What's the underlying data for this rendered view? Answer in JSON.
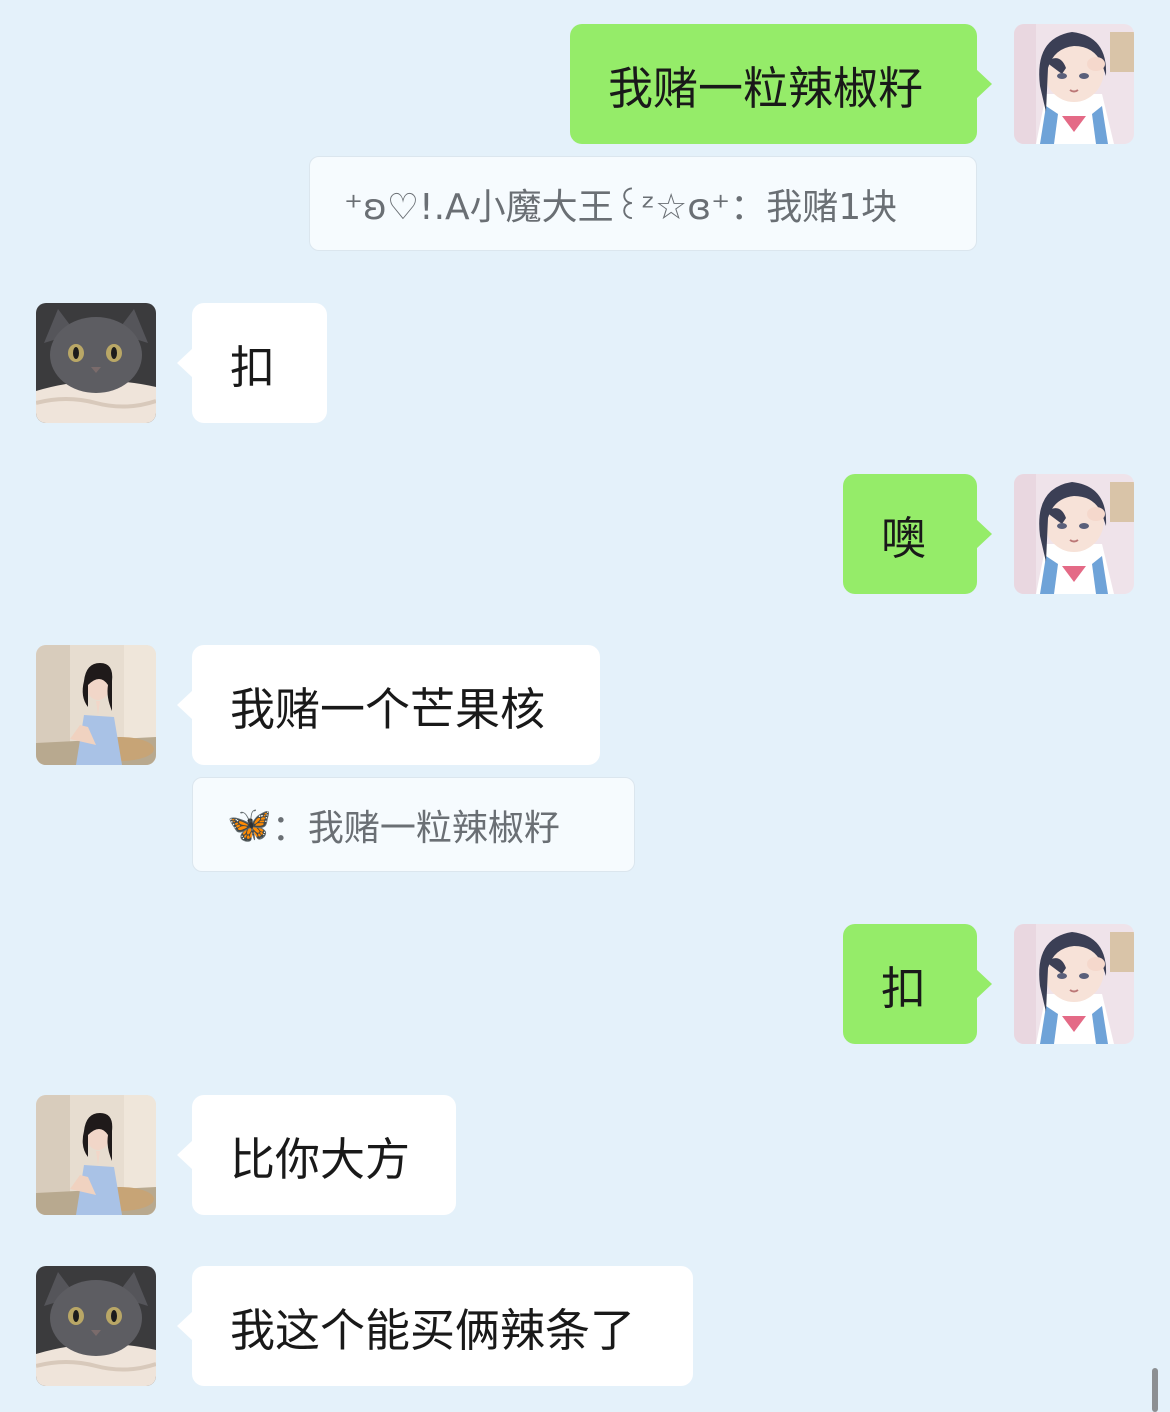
{
  "messages": [
    {
      "sender": "me",
      "avatar": "anime-girl-avatar",
      "text": "我赌一粒辣椒籽",
      "quote": {
        "author": "⁺ʚ♡!.A小魔大王꒰ᶻ☆ɞ⁺",
        "text": "我赌1块"
      }
    },
    {
      "sender": "other",
      "avatar": "gray-cat-avatar",
      "text": "扣"
    },
    {
      "sender": "me",
      "avatar": "anime-girl-avatar",
      "text": "噢"
    },
    {
      "sender": "other",
      "avatar": "woman-photo-avatar",
      "text": "我赌一个芒果核",
      "quote": {
        "author": "🦋",
        "text": "我赌一粒辣椒籽"
      }
    },
    {
      "sender": "me",
      "avatar": "anime-girl-avatar",
      "text": "扣"
    },
    {
      "sender": "other",
      "avatar": "woman-photo-avatar",
      "text": "比你大方"
    },
    {
      "sender": "other",
      "avatar": "gray-cat-avatar",
      "text": "我这个能买俩辣条了"
    }
  ],
  "quote_separator": "：",
  "colors": {
    "background": "#e4f1fa",
    "outgoing_bubble": "#95ec69",
    "incoming_bubble": "#ffffff",
    "quote_text": "#6a6f74"
  }
}
